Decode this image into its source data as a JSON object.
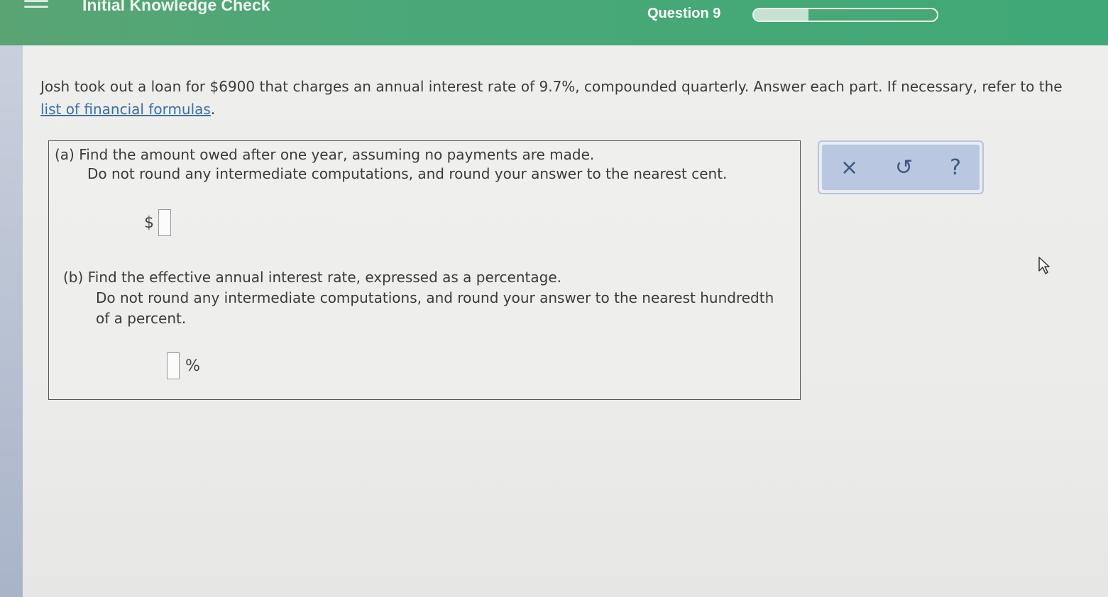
{
  "header": {
    "title": "Initial Knowledge Check",
    "question_label": "Question 9",
    "progress_fraction": 0.3
  },
  "problem": {
    "intro": "Josh took out a loan for $6900 that charges an annual interest rate of 9.7%, compounded quarterly. Answer each part. If necessary, refer to the",
    "link_text": "list of financial formulas",
    "trailing": "."
  },
  "part_a": {
    "label": "(a)",
    "line1": "Find the amount owed after one year, assuming no payments are made.",
    "line2": "Do not round any intermediate computations, and round your answer to the nearest cent.",
    "prefix": "$",
    "value": ""
  },
  "part_b": {
    "label": "(b)",
    "line1": "Find the effective annual interest rate, expressed as a percentage.",
    "line2": "Do not round any intermediate computations, and round your answer to the nearest hundredth",
    "line3": "of a percent.",
    "suffix": "%",
    "value": ""
  },
  "tools": {
    "clear": "×",
    "undo": "↺",
    "help": "?"
  },
  "colors": {
    "header_green": "#4ba878",
    "link_blue": "#3c6fa3",
    "tools_bg": "#b9c7e0"
  }
}
